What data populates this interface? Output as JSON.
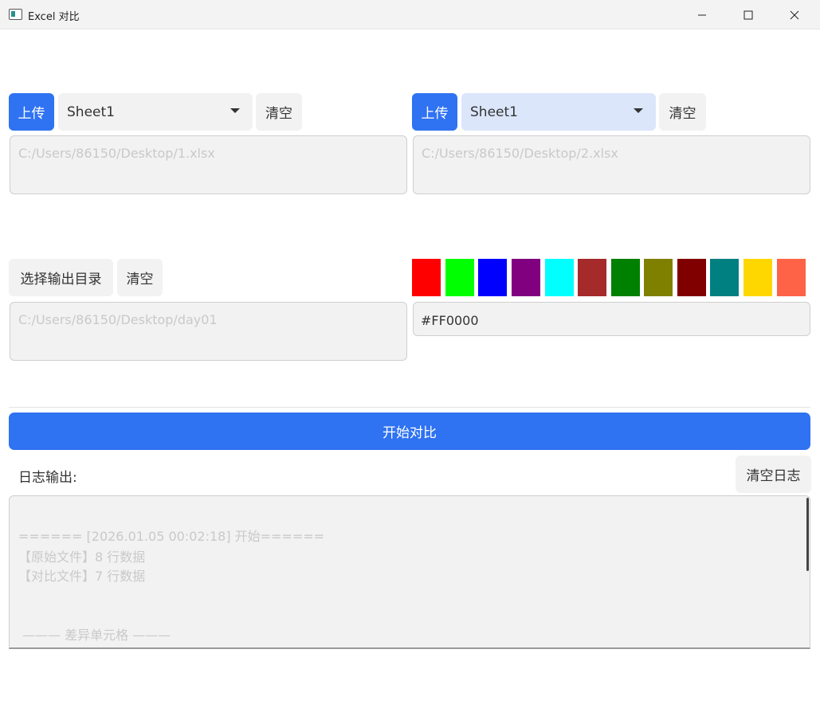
{
  "window": {
    "title": "Excel 对比"
  },
  "left": {
    "upload_label": "上传",
    "sheet": "Sheet1",
    "clear_label": "清空",
    "path": "C:/Users/86150/Desktop/1.xlsx"
  },
  "right": {
    "upload_label": "上传",
    "sheet": "Sheet1",
    "clear_label": "清空",
    "path": "C:/Users/86150/Desktop/2.xlsx"
  },
  "output": {
    "select_label": "选择输出目录",
    "clear_label": "清空",
    "path": "C:/Users/86150/Desktop/day01"
  },
  "colors": {
    "swatches": [
      "#FF0000",
      "#00FF00",
      "#0000FF",
      "#800080",
      "#00FFFF",
      "#A52A2A",
      "#008000",
      "#808000",
      "#800000",
      "#008080",
      "#FFD700",
      "#FF6347"
    ],
    "value": "#FF0000"
  },
  "start_label": "开始对比",
  "log": {
    "label": "日志输出:",
    "clear_label": "清空日志",
    "lines": [
      "====== [2026.01.05 00:02:18] 开始======",
      "【原始文件】8 行数据",
      "【对比文件】7 行数据",
      "——— 差异单元格 ———"
    ]
  }
}
